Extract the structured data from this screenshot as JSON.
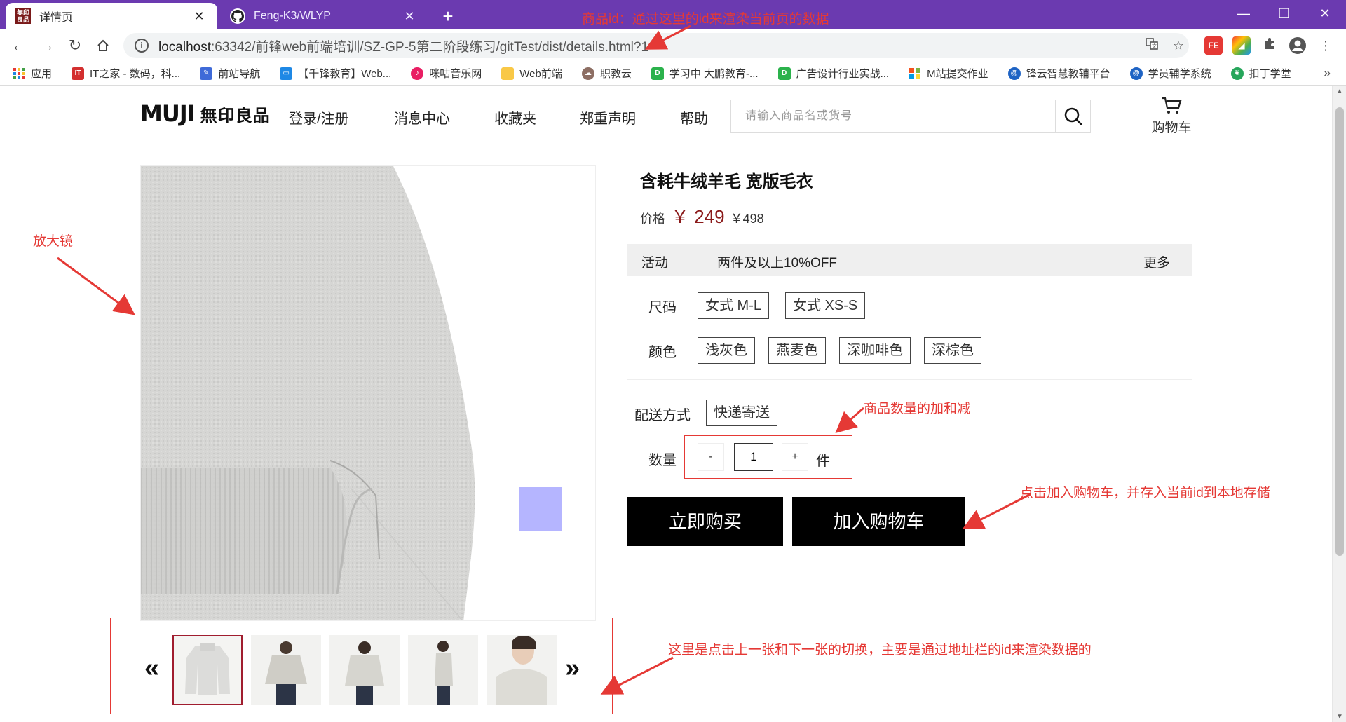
{
  "browser": {
    "tabs": [
      {
        "title": "详情页",
        "favicon": "无印良品"
      },
      {
        "title": "Feng-K3/WLYP",
        "favicon": "github"
      }
    ],
    "url_host": "localhost",
    "url_path": ":63342/前锋web前端培训/SZ-GP-5第二阶段练习/gitTest/dist/details.html?1",
    "bookmarks": [
      {
        "label": "应用",
        "icon": "apps-icon",
        "color": "#e53935"
      },
      {
        "label": "IT之家 - 数码，科...",
        "icon": "it-icon",
        "color": "#d32f2f"
      },
      {
        "label": "前站导航",
        "icon": "feather-icon",
        "color": "#3f6ad8"
      },
      {
        "label": "【千锋教育】Web...",
        "icon": "tv-icon",
        "color": "#1e88e5"
      },
      {
        "label": "咪咕音乐网",
        "icon": "migu-icon",
        "color": "#e91e63"
      },
      {
        "label": "Web前端",
        "icon": "folder-icon",
        "color": "#f9c846"
      },
      {
        "label": "职教云",
        "icon": "cloud-icon",
        "color": "#8d6e63"
      },
      {
        "label": "学习中 大鹏教育-...",
        "icon": "d-icon",
        "color": "#2bb24c"
      },
      {
        "label": "广告设计行业实战...",
        "icon": "d-icon",
        "color": "#2bb24c"
      },
      {
        "label": "M站提交作业",
        "icon": "windows-icon",
        "color": "#f4511e"
      },
      {
        "label": "锋云智慧教辅平台",
        "icon": "swirl-icon",
        "color": "#1e63c4"
      },
      {
        "label": "学员辅学系统",
        "icon": "swirl-icon",
        "color": "#1e63c4"
      },
      {
        "label": "扣丁学堂",
        "icon": "leaf-icon",
        "color": "#26a65b"
      }
    ]
  },
  "site": {
    "logo_latin": "MUJI",
    "logo_kanji": "無印良品",
    "nav": [
      "登录/注册",
      "消息中心",
      "收藏夹",
      "郑重声明",
      "帮助"
    ],
    "search_placeholder": "请输入商品名或货号",
    "cart_label": "购物车"
  },
  "product": {
    "title": "含耗牛绒羊毛 宽版毛衣",
    "price_label": "价格",
    "price_now": "￥ 249",
    "price_old": "￥498",
    "promo_label": "活动",
    "promo_text": "两件及以上10%OFF",
    "promo_more": "更多",
    "size_label": "尺码",
    "sizes": [
      "女式 M-L",
      "女式 XS-S"
    ],
    "color_label": "颜色",
    "colors": [
      "浅灰色",
      "燕麦色",
      "深咖啡色",
      "深棕色"
    ],
    "shipping_label": "配送方式",
    "shipping_option": "快递寄送",
    "qty_label": "数量",
    "qty_minus": "-",
    "qty_value": "1",
    "qty_plus": "+",
    "qty_unit": "件",
    "buy_now": "立即购买",
    "add_cart": "加入购物车",
    "thumb_prev": "«",
    "thumb_next": "»",
    "thumbs_count": 5,
    "selected_thumb": 1
  },
  "annotations": {
    "product_id": "商品id：通过这里的id来渲染当前页的数据",
    "magnifier": "放大镜",
    "qty": "商品数量的加和减",
    "add_cart": "点击加入购物车，并存入当前id到本地存储",
    "thumbs": "这里是点击上一张和下一张的切换，主要是通过地址栏的id来渲染数据的"
  },
  "colors": {
    "tabbar": "#6b3ab0",
    "annotation": "#e53935",
    "price": "#8b1a1a",
    "zoom_box": "#9696ff"
  }
}
